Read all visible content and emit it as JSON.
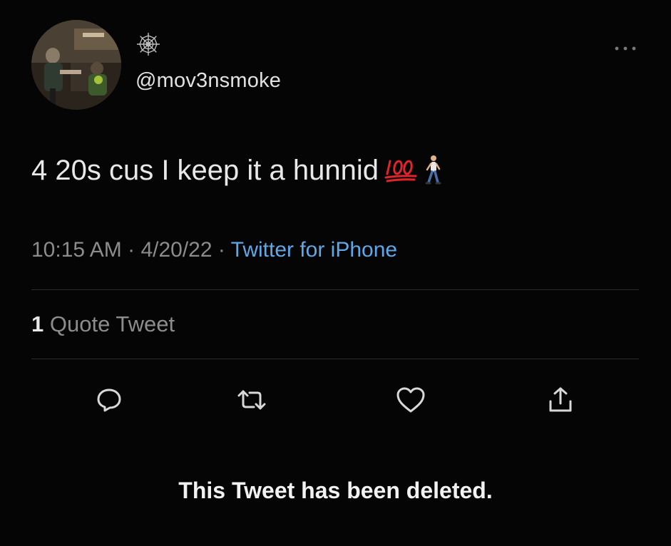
{
  "user": {
    "handle": "@mov3nsmoke",
    "avatar_icon": "profile-photo-avatar",
    "badge_icon": "spider-web-icon"
  },
  "tweet": {
    "text": "4 20s cus I keep it a hunnid",
    "emojis": [
      "hundred-points-emoji",
      "person-walking-emoji"
    ],
    "time": "10:15 AM",
    "separator": " · ",
    "date": "4/20/22",
    "source": "Twitter for iPhone"
  },
  "stats": {
    "quote_count": "1",
    "quote_label": " Quote Tweet"
  },
  "actions": [
    {
      "icon": "reply-icon"
    },
    {
      "icon": "retweet-icon"
    },
    {
      "icon": "like-heart-icon"
    },
    {
      "icon": "share-icon"
    }
  ],
  "notice": "This Tweet has been deleted.",
  "colors": {
    "background": "#050505",
    "text": "#e8e8e8",
    "muted": "#8c8c8c",
    "link": "#5fa8e8",
    "divider": "#2b2b2b",
    "emoji_red": "#e0242b"
  }
}
